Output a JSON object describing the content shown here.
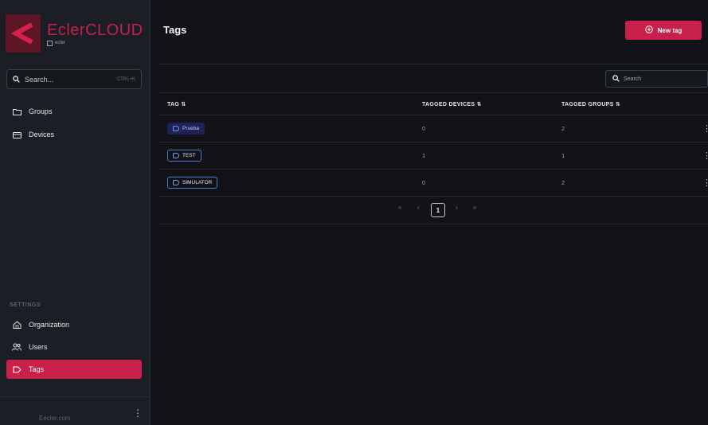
{
  "app": {
    "logo_text": "EclerCLOUD",
    "logo_sub": "ecler"
  },
  "sidebar": {
    "search_placeholder": "Search...",
    "search_shortcut": "CTRL+K",
    "items": [
      {
        "label": "Groups",
        "icon": "folder-icon"
      },
      {
        "label": "Devices",
        "icon": "device-icon"
      }
    ],
    "settings_label": "SETTINGS",
    "settings_items": [
      {
        "label": "Organization",
        "icon": "home-icon"
      },
      {
        "label": "Users",
        "icon": "users-icon"
      },
      {
        "label": "Tags",
        "icon": "tag-icon",
        "active": true
      }
    ],
    "footer_text": "Eecler.com"
  },
  "header": {
    "title": "Tags",
    "new_button": "New tag"
  },
  "toolbar": {
    "search_placeholder": "Search"
  },
  "table": {
    "columns": [
      "TAG",
      "TAGGED DEVICES",
      "TAGGED GROUPS"
    ],
    "rows": [
      {
        "tag": "Prueba",
        "devices": "0",
        "groups": "2",
        "style": "filled"
      },
      {
        "tag": "TEST",
        "devices": "1",
        "groups": "1",
        "style": "outline"
      },
      {
        "tag": "SIMULATOR",
        "devices": "0",
        "groups": "2",
        "style": "outline"
      }
    ]
  },
  "pagination": {
    "first": "«",
    "prev": "‹",
    "current": "1",
    "next": "›",
    "last": "»"
  },
  "colors": {
    "accent": "#c8204a",
    "background": "#111318",
    "sidebar": "#1b1e24",
    "tag_outline": "#4a7fd1",
    "tag_fill": "#1f2157"
  }
}
